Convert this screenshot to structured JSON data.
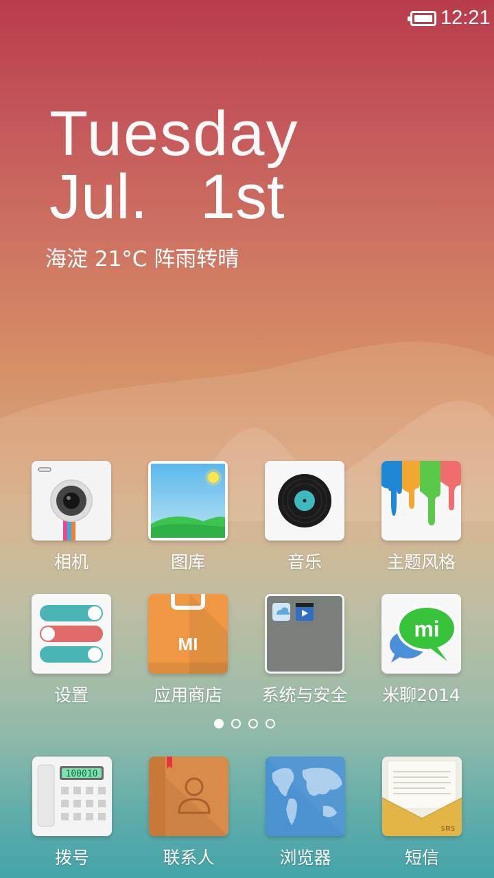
{
  "status_bar": {
    "time": "12:21",
    "battery_icon": "battery-full-icon"
  },
  "date_widget": {
    "weekday": "Tuesday",
    "month": "Jul.",
    "day": "1st",
    "weather": "海淀 21°C 阵雨转晴"
  },
  "apps_row1": [
    {
      "label": "相机",
      "icon": "camera-icon"
    },
    {
      "label": "图库",
      "icon": "gallery-icon"
    },
    {
      "label": "音乐",
      "icon": "music-icon"
    },
    {
      "label": "主题风格",
      "icon": "themes-icon"
    }
  ],
  "apps_row2": [
    {
      "label": "设置",
      "icon": "settings-icon"
    },
    {
      "label": "应用商店",
      "icon": "app-store-icon"
    },
    {
      "label": "系统与安全",
      "icon": "folder-icon"
    },
    {
      "label": "米聊2014",
      "icon": "miliao-icon"
    }
  ],
  "dock": [
    {
      "label": "拨号",
      "icon": "phone-icon"
    },
    {
      "label": "联系人",
      "icon": "contacts-icon"
    },
    {
      "label": "浏览器",
      "icon": "browser-icon"
    },
    {
      "label": "短信",
      "icon": "sms-icon"
    }
  ],
  "page_indicator": {
    "pages": 4,
    "current": 1
  },
  "icon_text": {
    "dialer_display": "100010",
    "store_logo": "MI",
    "miliao_logo": "mi",
    "sms_tag": "sms"
  },
  "colors": {
    "settings_toggle_teal": "#4ab5b4",
    "settings_toggle_red": "#e06a6a",
    "app_store_orange": "#ef9743",
    "miliao_green": "#38c43a",
    "contacts_brown": "#d98b4a",
    "browser_blue": "#4a93d0",
    "sms_yellow": "#e2b547"
  }
}
